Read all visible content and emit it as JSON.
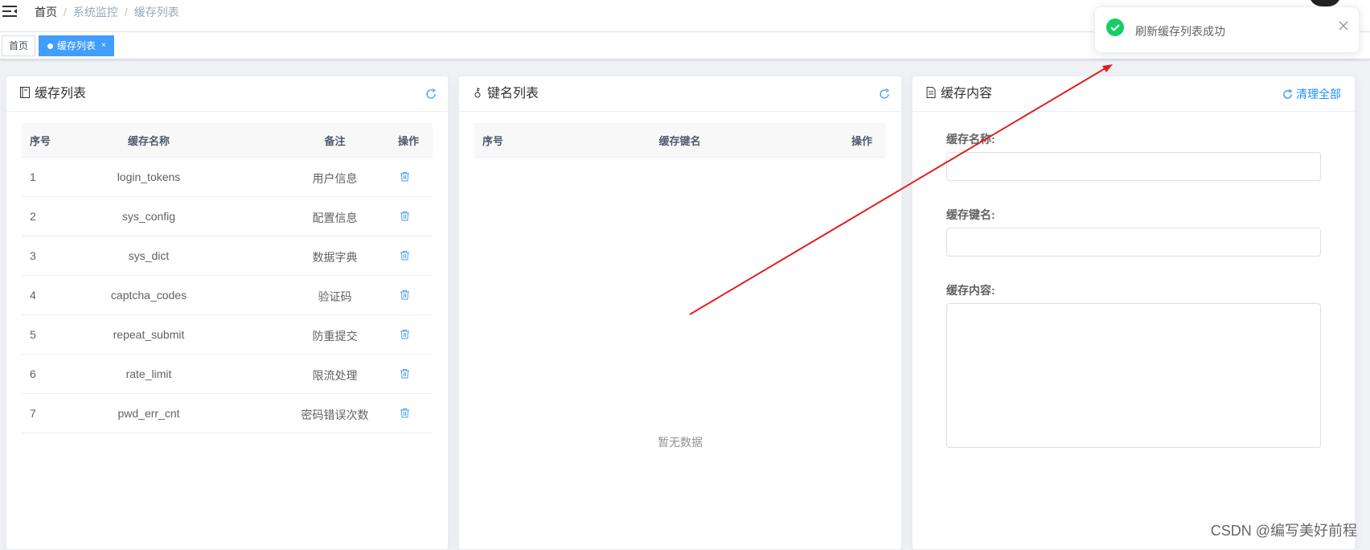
{
  "navbar": {
    "breadcrumb": [
      "首页",
      "系统监控",
      "缓存列表"
    ]
  },
  "tags": {
    "home": "首页",
    "active": "缓存列表",
    "active_close": "×"
  },
  "cache_list": {
    "title": "缓存列表",
    "headers": [
      "序号",
      "缓存名称",
      "备注",
      "操作"
    ],
    "rows": [
      {
        "no": "1",
        "name": "login_tokens",
        "remark": "用户信息"
      },
      {
        "no": "2",
        "name": "sys_config",
        "remark": "配置信息"
      },
      {
        "no": "3",
        "name": "sys_dict",
        "remark": "数据字典"
      },
      {
        "no": "4",
        "name": "captcha_codes",
        "remark": "验证码"
      },
      {
        "no": "5",
        "name": "repeat_submit",
        "remark": "防重提交"
      },
      {
        "no": "6",
        "name": "rate_limit",
        "remark": "限流处理"
      },
      {
        "no": "7",
        "name": "pwd_err_cnt",
        "remark": "密码错误次数"
      }
    ]
  },
  "key_list": {
    "title": "键名列表",
    "headers": [
      "序号",
      "缓存键名",
      "操作"
    ],
    "empty_text": "暂无数据"
  },
  "cache_content": {
    "title": "缓存内容",
    "clear_label": "清理全部",
    "labels": {
      "name": "缓存名称:",
      "key": "缓存键名:",
      "content": "缓存内容:"
    }
  },
  "toast": {
    "message": "刷新缓存列表成功",
    "color": "#13ce66"
  },
  "watermark": "CSDN @编写美好前程",
  "colors": {
    "primary": "#409eff",
    "link": "#1890ff",
    "annotation": "#e02020"
  }
}
